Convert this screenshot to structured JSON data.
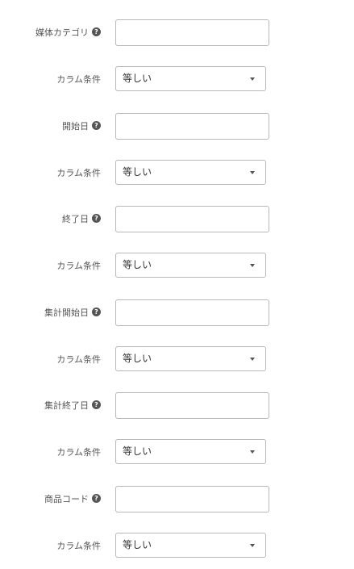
{
  "form": {
    "media_category": {
      "label": "媒体カテゴリ",
      "value": ""
    },
    "media_category_condition": {
      "label": "カラム条件",
      "value": "等しい"
    },
    "start_date": {
      "label": "開始日",
      "value": ""
    },
    "start_date_condition": {
      "label": "カラム条件",
      "value": "等しい"
    },
    "end_date": {
      "label": "終了日",
      "value": ""
    },
    "end_date_condition": {
      "label": "カラム条件",
      "value": "等しい"
    },
    "aggregate_start_date": {
      "label": "集計開始日",
      "value": ""
    },
    "aggregate_start_date_condition": {
      "label": "カラム条件",
      "value": "等しい"
    },
    "aggregate_end_date": {
      "label": "集計終了日",
      "value": ""
    },
    "aggregate_end_date_condition": {
      "label": "カラム条件",
      "value": "等しい"
    },
    "product_code": {
      "label": "商品コード",
      "value": ""
    },
    "product_code_condition": {
      "label": "カラム条件",
      "value": "等しい"
    }
  },
  "icons": {
    "help": "question-circle-icon",
    "dropdown": "caret-down-icon"
  },
  "colors": {
    "label_text": "#555555",
    "border": "#b8b8b8",
    "value_text": "#333333"
  }
}
